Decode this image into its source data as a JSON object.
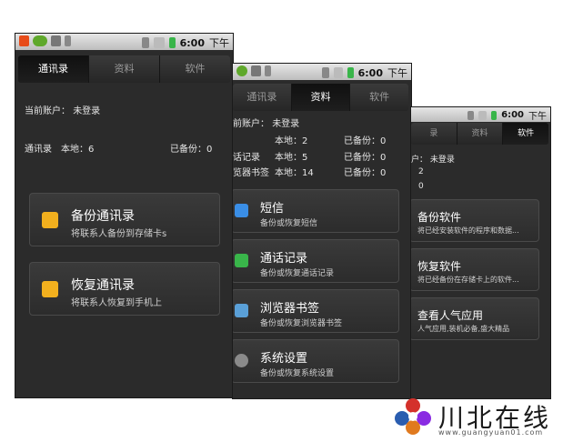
{
  "status": {
    "time": "6:00",
    "ampm": "下午"
  },
  "phone1": {
    "tabs": [
      "通讯录",
      "资料",
      "软件"
    ],
    "active_tab": 0,
    "account_label": "当前账户：",
    "account_value": "未登录",
    "stats": {
      "name": "通讯录",
      "local": "本地：6",
      "backup": "已备份：0"
    },
    "actions": [
      {
        "title": "备份通讯录",
        "subtitle": "将联系人备份到存储卡s",
        "icon": "contact-card-icon"
      },
      {
        "title": "恢复通讯录",
        "subtitle": "将联系人恢复到手机上",
        "icon": "contact-card-icon"
      }
    ]
  },
  "phone2": {
    "tabs": [
      "通讯录",
      "资料",
      "软件"
    ],
    "active_tab": 1,
    "account_label": "前账户：",
    "account_value": "未登录",
    "stats": [
      {
        "name": "",
        "local": "本地：2",
        "backup": "已备份：0"
      },
      {
        "name": "话记录",
        "local": "本地：5",
        "backup": "已备份：0"
      },
      {
        "name": "览器书签",
        "local": "本地：14",
        "backup": "已备份：0"
      }
    ],
    "actions": [
      {
        "title": "短信",
        "subtitle": "备份或恢复短信",
        "icon": "sms-icon"
      },
      {
        "title": "通话记录",
        "subtitle": "备份或恢复通话记录",
        "icon": "phone-icon"
      },
      {
        "title": "浏览器书签",
        "subtitle": "备份或恢复浏览器书签",
        "icon": "bookmark-icon"
      },
      {
        "title": "系统设置",
        "subtitle": "备份或恢复系统设置",
        "icon": "gear-icon"
      }
    ]
  },
  "phone3": {
    "tabs": [
      "录",
      "资料",
      "软件"
    ],
    "active_tab": 2,
    "account_label": "户：",
    "account_value": "未登录",
    "stats": [
      "2",
      "0"
    ],
    "actions": [
      {
        "title": "备份软件",
        "subtitle": "将已经安装软件的程序和数据..."
      },
      {
        "title": "恢复软件",
        "subtitle": "将已经备份在存储卡上的软件..."
      },
      {
        "title": "查看人气应用",
        "subtitle": "人气应用,装机必备,盛大精品"
      }
    ]
  },
  "watermark": {
    "brand": "川北在线",
    "url": "www.guangyuan01.com"
  },
  "colors": {
    "screen_bg": "#2b2b2b",
    "accent_green": "#39b54a",
    "accent_yellow": "#f2b01e"
  }
}
